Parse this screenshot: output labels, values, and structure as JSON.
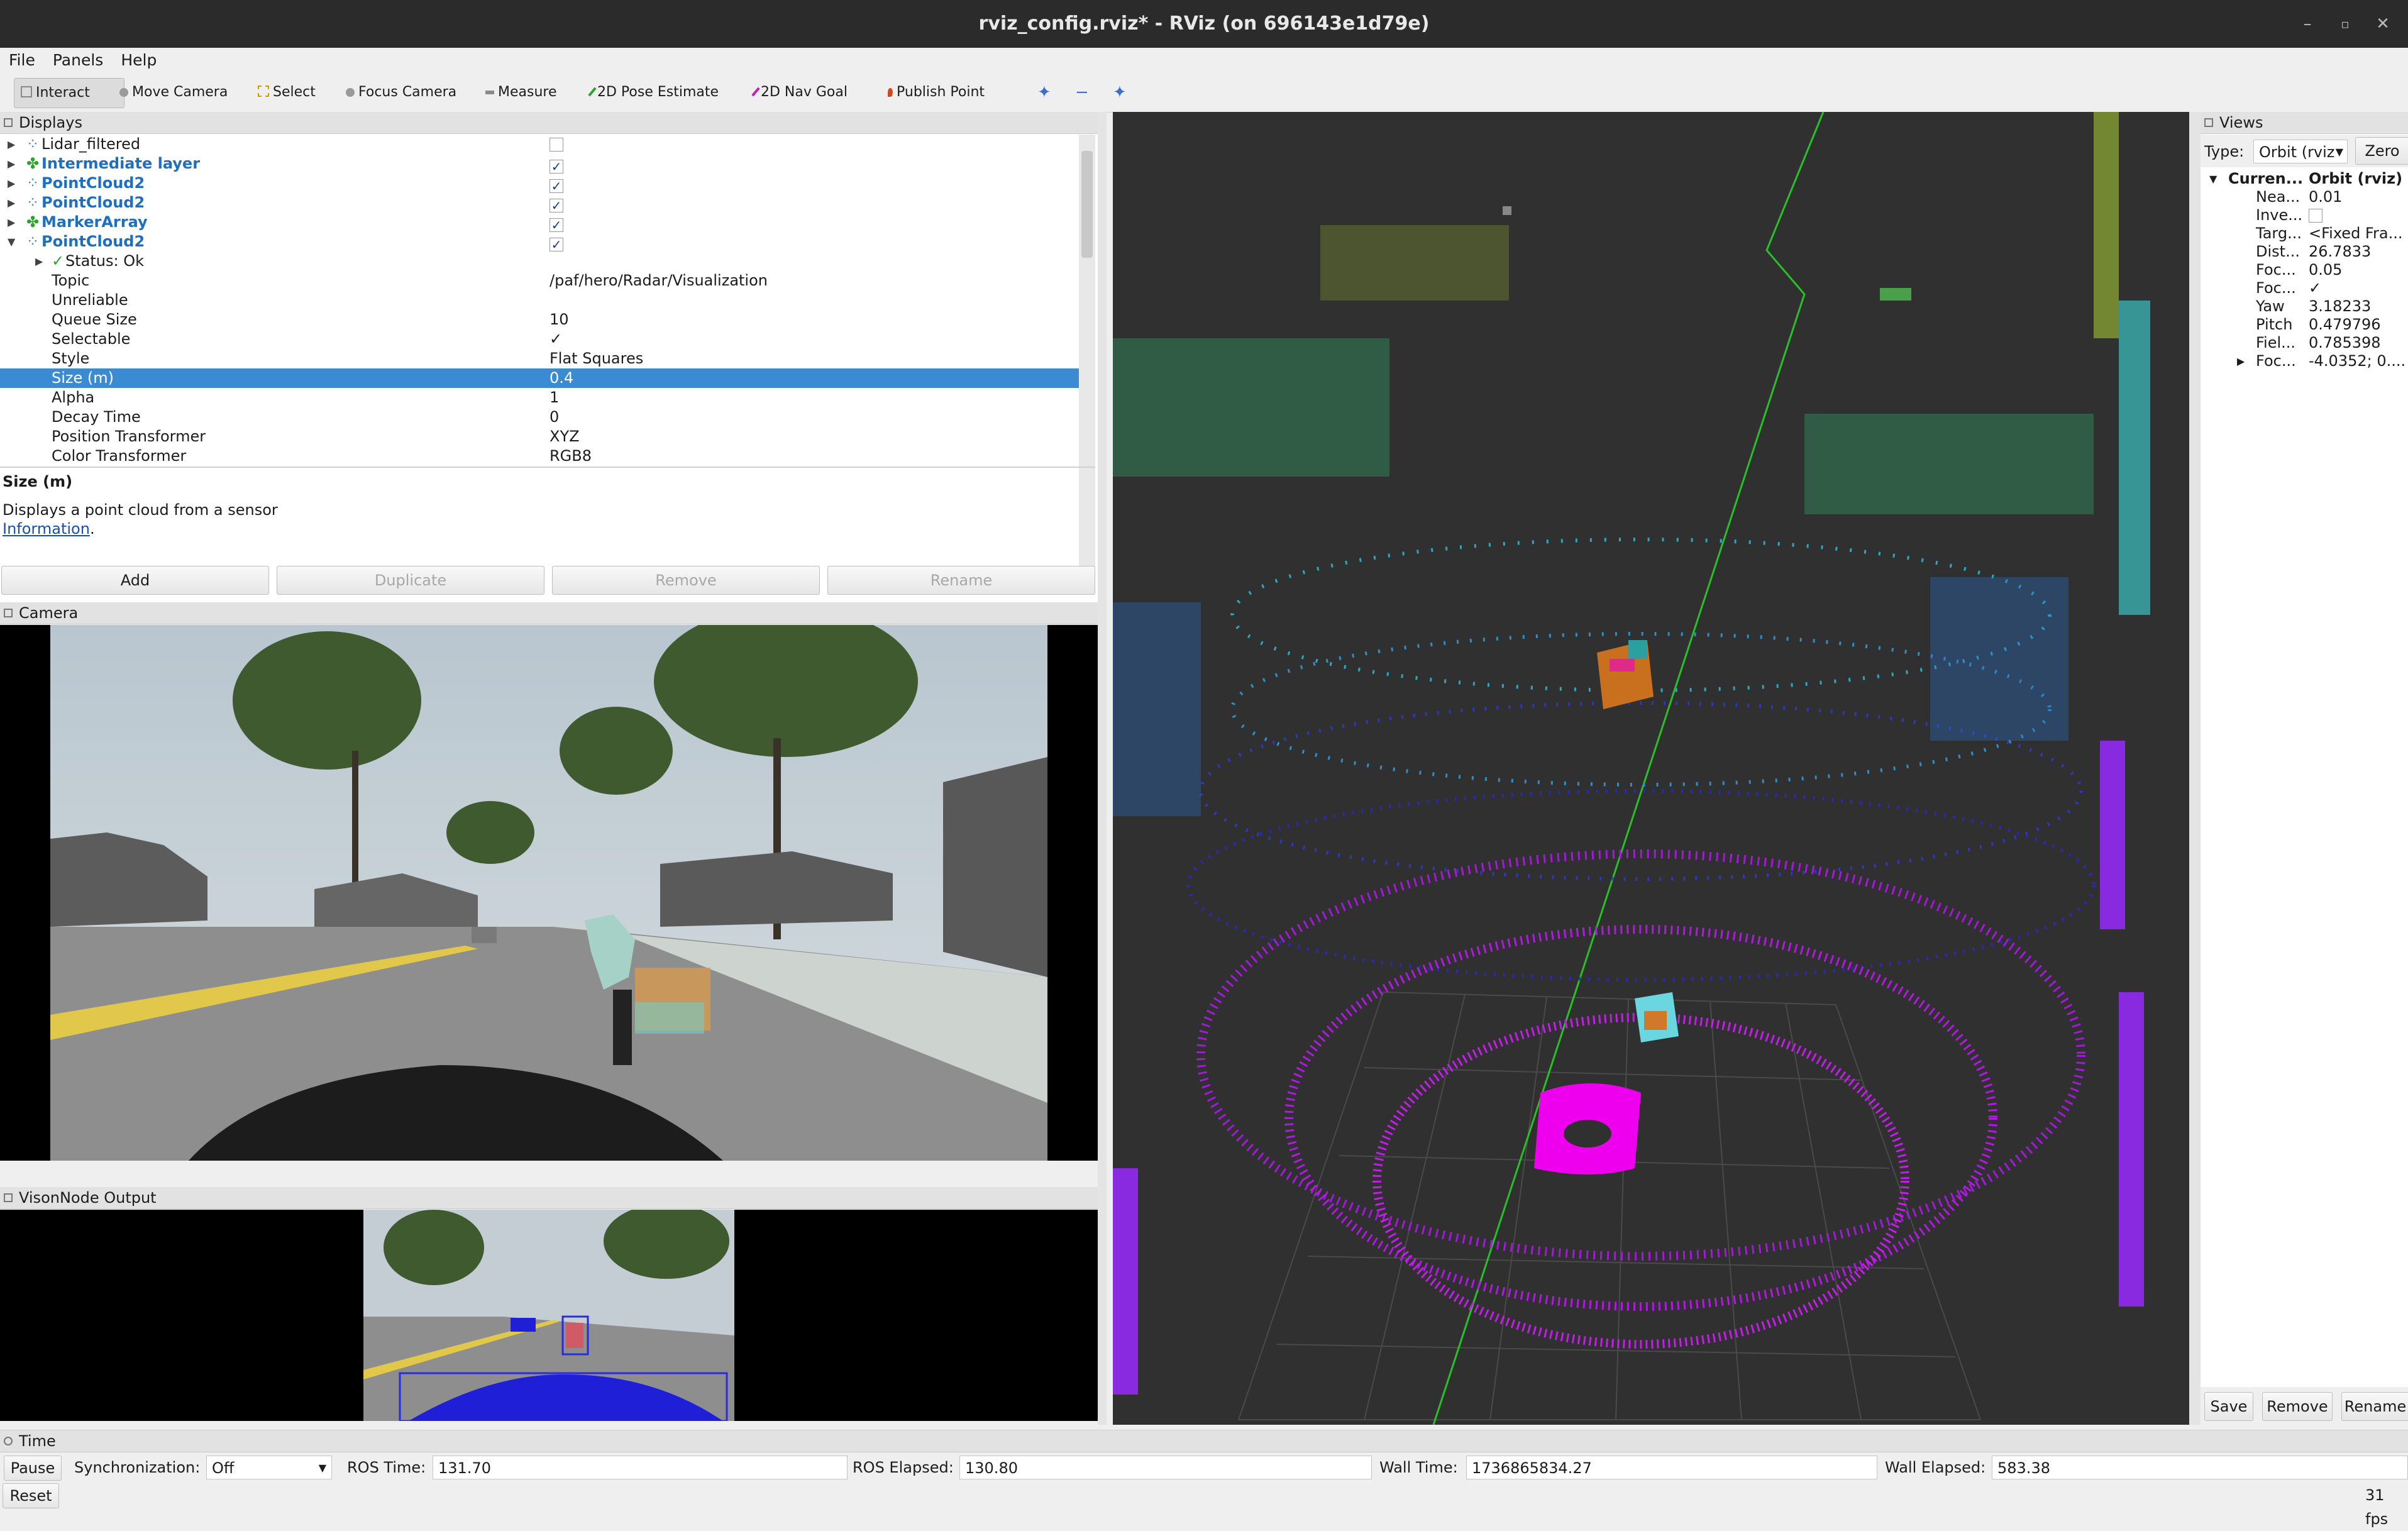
{
  "window": {
    "title": "rviz_config.rviz* - RViz (on 696143e1d79e)"
  },
  "menu": {
    "file": "File",
    "panels": "Panels",
    "help": "Help"
  },
  "toolbar": {
    "interact": "Interact",
    "move_camera": "Move Camera",
    "select": "Select",
    "focus_camera": "Focus Camera",
    "measure": "Measure",
    "pose_estimate": "2D Pose Estimate",
    "nav_goal": "2D Nav Goal",
    "publish_point": "Publish Point"
  },
  "displays": {
    "title": "Displays",
    "items": [
      {
        "label": "Lidar_filtered",
        "checked": false
      },
      {
        "label": "Intermediate layer",
        "checked": true
      },
      {
        "label": "PointCloud2",
        "checked": true
      },
      {
        "label": "PointCloud2",
        "checked": true
      },
      {
        "label": "MarkerArray",
        "checked": true
      },
      {
        "label": "PointCloud2",
        "checked": true
      }
    ],
    "status": "Status: Ok",
    "properties": [
      {
        "name": "Topic",
        "value": "/paf/hero/Radar/Visualization"
      },
      {
        "name": "Unreliable",
        "value": ""
      },
      {
        "name": "Queue Size",
        "value": "10"
      },
      {
        "name": "Selectable",
        "value": "✓"
      },
      {
        "name": "Style",
        "value": "Flat Squares"
      },
      {
        "name": "Size (m)",
        "value": "0.4"
      },
      {
        "name": "Alpha",
        "value": "1"
      },
      {
        "name": "Decay Time",
        "value": "0"
      },
      {
        "name": "Position Transformer",
        "value": "XYZ"
      },
      {
        "name": "Color Transformer",
        "value": "RGB8"
      }
    ],
    "desc_title": "Size (m)",
    "desc_text": "Displays a point cloud from a sensor",
    "desc_link": "Information",
    "desc_punct": ".",
    "buttons": {
      "add": "Add",
      "duplicate": "Duplicate",
      "remove": "Remove",
      "rename": "Rename"
    }
  },
  "camera": {
    "title": "Camera"
  },
  "vision": {
    "title": "VisonNode Output"
  },
  "views": {
    "title": "Views",
    "type_label": "Type:",
    "type_value": "Orbit (rviz",
    "zero": "Zero",
    "current_name": "Curren...",
    "current_value": "Orbit (rviz)",
    "props": [
      {
        "name": "Nea...",
        "value": "0.01"
      },
      {
        "name": "Inve...",
        "value": ""
      },
      {
        "name": "Targ...",
        "value": "<Fixed Fra..."
      },
      {
        "name": "Dist...",
        "value": "26.7833"
      },
      {
        "name": "Foc...",
        "value": "0.05"
      },
      {
        "name": "Foc...",
        "value": "✓"
      },
      {
        "name": "Yaw",
        "value": "3.18233"
      },
      {
        "name": "Pitch",
        "value": "0.479796"
      },
      {
        "name": "Fiel...",
        "value": "0.785398"
      },
      {
        "name": "Foc...",
        "value": "-4.0352; 0...."
      }
    ],
    "buttons": {
      "save": "Save",
      "remove": "Remove",
      "rename": "Rename"
    }
  },
  "time": {
    "title": "Time",
    "pause": "Pause",
    "sync_label": "Synchronization:",
    "sync_value": "Off",
    "ros_time_label": "ROS Time:",
    "ros_time": "131.70",
    "ros_elapsed_label": "ROS Elapsed:",
    "ros_elapsed": "130.80",
    "wall_time_label": "Wall Time:",
    "wall_time": "1736865834.27",
    "wall_elapsed_label": "Wall Elapsed:",
    "wall_elapsed": "583.38",
    "reset": "Reset",
    "fps": "31 fps"
  }
}
